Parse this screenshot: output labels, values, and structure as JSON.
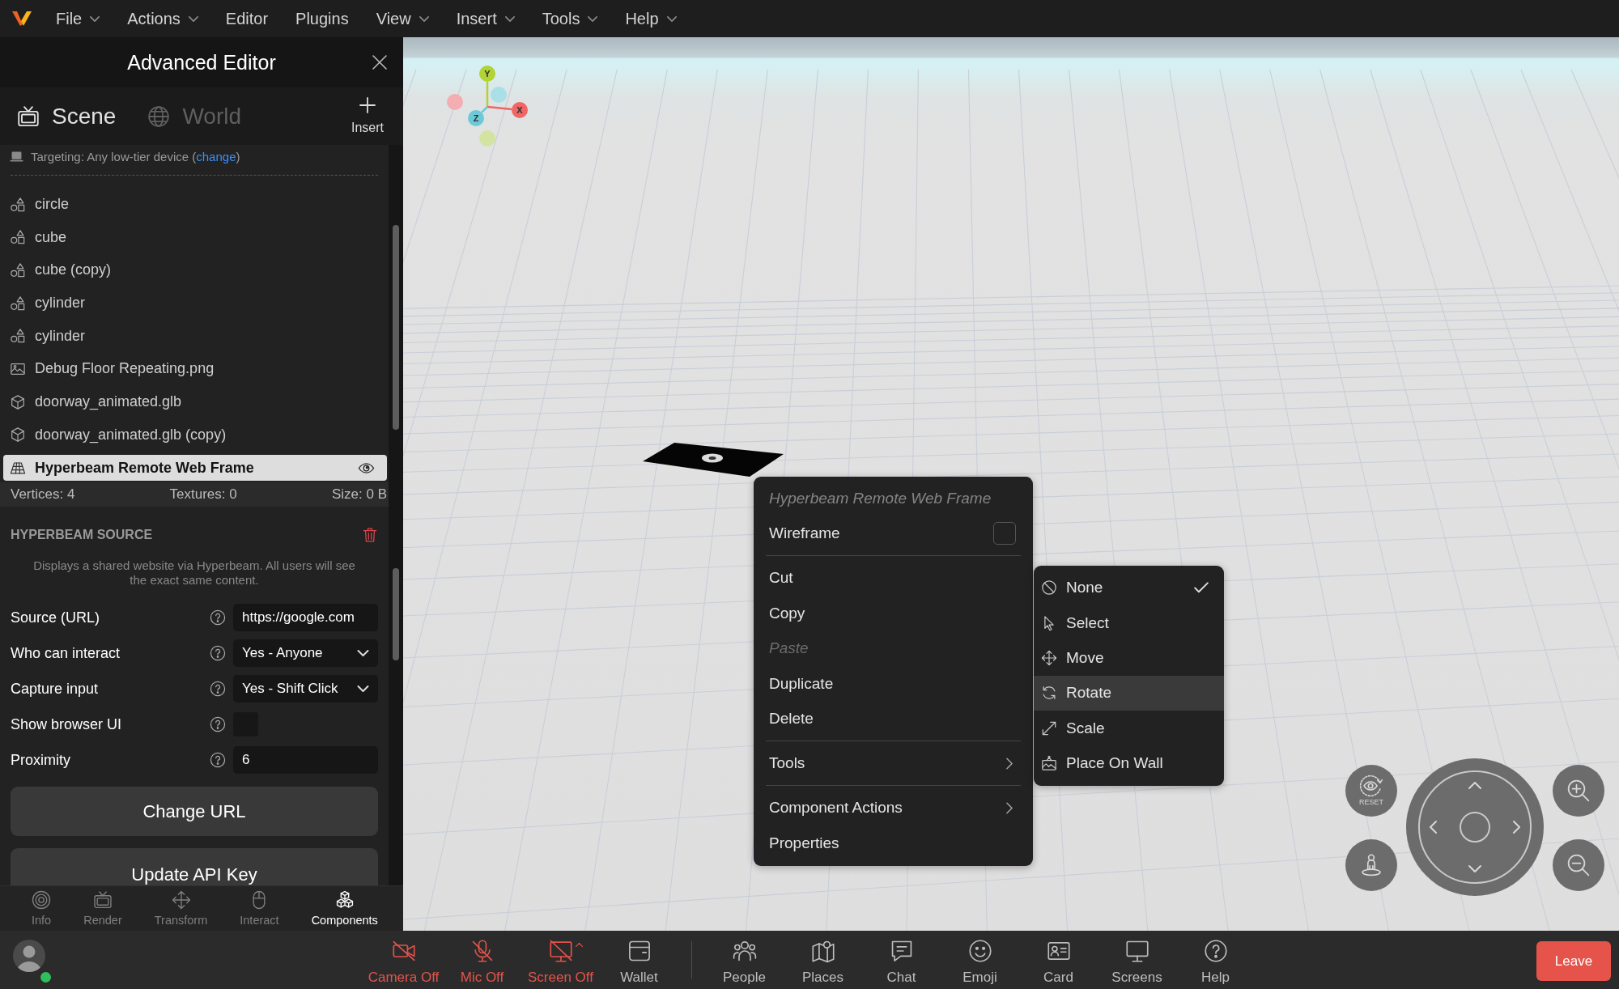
{
  "menu_bar": {
    "items": [
      {
        "label": "File",
        "dropdown": true
      },
      {
        "label": "Actions",
        "dropdown": true
      },
      {
        "label": "Editor",
        "dropdown": false
      },
      {
        "label": "Plugins",
        "dropdown": false
      },
      {
        "label": "View",
        "dropdown": true
      },
      {
        "label": "Insert",
        "dropdown": true
      },
      {
        "label": "Tools",
        "dropdown": true
      },
      {
        "label": "Help",
        "dropdown": true
      }
    ]
  },
  "editor_panel": {
    "title": "Advanced Editor",
    "tabs": [
      {
        "label": "Scene",
        "selected": true
      },
      {
        "label": "World",
        "selected": false
      }
    ],
    "insert_label": "Insert",
    "targeting": {
      "prefix": "Targeting: Any low-tier device (",
      "link": "change",
      "suffix": ")"
    },
    "scene_items": [
      {
        "name": "circle",
        "kind": "primitive",
        "selected": false
      },
      {
        "name": "cube",
        "kind": "primitive",
        "selected": false
      },
      {
        "name": "cube (copy)",
        "kind": "primitive",
        "selected": false
      },
      {
        "name": "cylinder",
        "kind": "primitive",
        "selected": false
      },
      {
        "name": "cylinder",
        "kind": "primitive",
        "selected": false
      },
      {
        "name": "Debug Floor Repeating.png",
        "kind": "image",
        "selected": false
      },
      {
        "name": "doorway_animated.glb",
        "kind": "model",
        "selected": false
      },
      {
        "name": "doorway_animated.glb (copy)",
        "kind": "model",
        "selected": false
      },
      {
        "name": "Hyperbeam Remote Web Frame",
        "kind": "web_frame",
        "selected": true
      }
    ],
    "stats": [
      "Vertices: 4",
      "Textures: 0",
      "Size: 0 B"
    ],
    "component": {
      "title": "HYPERBEAM SOURCE",
      "description": "Displays a shared website via Hyperbeam. All users will see the exact same content.",
      "properties": [
        {
          "label": "Source (URL)",
          "kind": "text",
          "value": "https://google.com"
        },
        {
          "label": "Who can interact",
          "kind": "select",
          "value": "Yes - Anyone"
        },
        {
          "label": "Capture input",
          "kind": "select",
          "value": "Yes - Shift Click"
        },
        {
          "label": "Show browser UI",
          "kind": "checkbox",
          "checked": false
        },
        {
          "label": "Proximity",
          "kind": "number",
          "value": "6"
        }
      ],
      "buttons": [
        "Change URL",
        "Update API Key"
      ]
    },
    "bottom_tabs": [
      {
        "label": "Info",
        "selected": false
      },
      {
        "label": "Render",
        "selected": false
      },
      {
        "label": "Transform",
        "selected": false
      },
      {
        "label": "Interact",
        "selected": false
      },
      {
        "label": "Components",
        "selected": true
      }
    ]
  },
  "viewport": {
    "gizmo_axes": [
      {
        "label": "Y",
        "color": "#b2d235"
      },
      {
        "label": "X",
        "color": "#f06565"
      },
      {
        "label": "Z",
        "color": "#6ccad8"
      },
      {
        "color": "#d3e4a0"
      },
      {
        "color": "#f4aeb1"
      },
      {
        "color": "#a9e0e8"
      }
    ]
  },
  "context_menu": {
    "title": "Hyperbeam Remote Web Frame",
    "sections": [
      [
        {
          "kind": "toggle",
          "label": "Wireframe",
          "checked": false,
          "disabled": false
        }
      ],
      [
        {
          "kind": "action",
          "label": "Cut",
          "disabled": false
        },
        {
          "kind": "action",
          "label": "Copy",
          "disabled": false
        },
        {
          "kind": "action",
          "label": "Paste",
          "disabled": true
        },
        {
          "kind": "action",
          "label": "Duplicate",
          "disabled": false
        },
        {
          "kind": "action",
          "label": "Delete",
          "disabled": false
        }
      ],
      [
        {
          "kind": "submenu",
          "label": "Tools",
          "disabled": false
        }
      ],
      [
        {
          "kind": "submenu",
          "label": "Component Actions",
          "disabled": false
        },
        {
          "kind": "action",
          "label": "Properties",
          "disabled": false
        }
      ]
    ]
  },
  "tools_submenu": {
    "items": [
      {
        "label": "None",
        "checked": true,
        "highlighted": false
      },
      {
        "label": "Select",
        "checked": false,
        "highlighted": false
      },
      {
        "label": "Move",
        "checked": false,
        "highlighted": false
      },
      {
        "label": "Rotate",
        "checked": false,
        "highlighted": true
      },
      {
        "label": "Scale",
        "checked": false,
        "highlighted": false
      },
      {
        "label": "Place On Wall",
        "checked": false,
        "highlighted": false
      }
    ]
  },
  "view_controls": {
    "reset_label": "RESET"
  },
  "bottom_bar": {
    "avatar_online": true,
    "groups": [
      [
        {
          "label": "Camera Off",
          "off": true,
          "dropdown": false
        },
        {
          "label": "Mic Off",
          "off": true,
          "dropdown": false
        },
        {
          "label": "Screen Off",
          "off": true,
          "dropdown": true
        },
        {
          "label": "Wallet",
          "off": false,
          "dropdown": false
        }
      ],
      [
        {
          "label": "People",
          "off": false,
          "dropdown": false
        },
        {
          "label": "Places",
          "off": false,
          "dropdown": false
        },
        {
          "label": "Chat",
          "off": false,
          "dropdown": false
        },
        {
          "label": "Emoji",
          "off": false,
          "dropdown": false
        },
        {
          "label": "Card",
          "off": false,
          "dropdown": false
        },
        {
          "label": "Screens",
          "off": false,
          "dropdown": false
        },
        {
          "label": "Help",
          "off": false,
          "dropdown": false
        }
      ]
    ],
    "leave_label": "Leave"
  }
}
